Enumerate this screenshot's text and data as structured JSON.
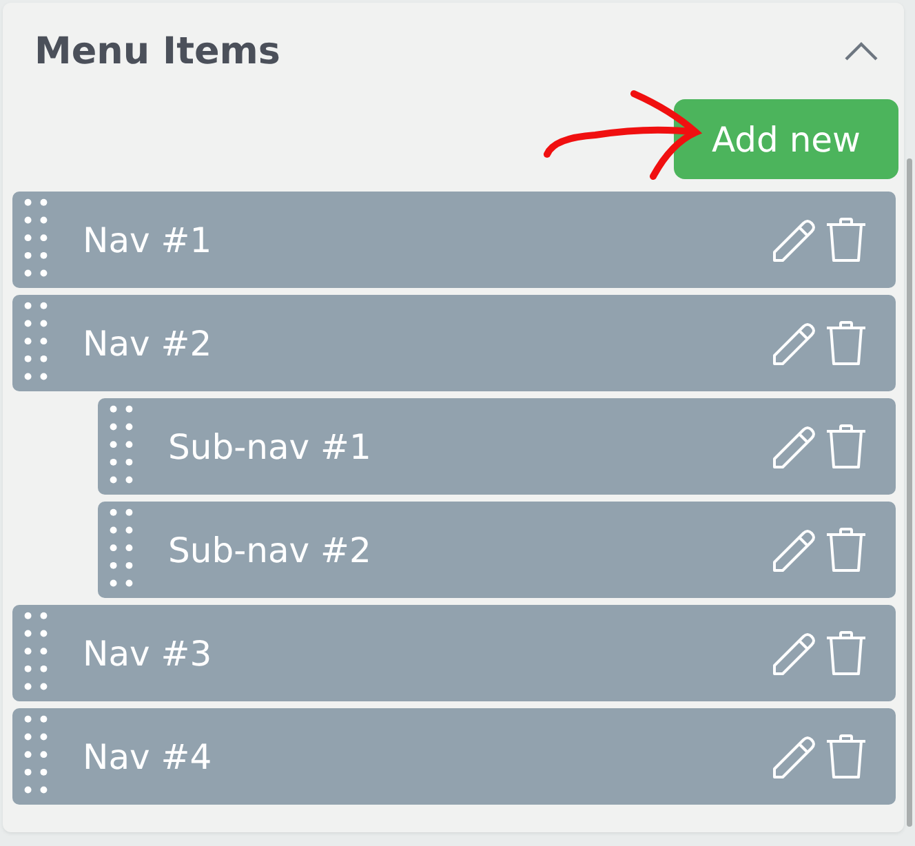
{
  "panel": {
    "title": "Menu Items",
    "expanded": true
  },
  "add_button": {
    "label": "Add new"
  },
  "menu_items": [
    {
      "label": "Nav #1"
    },
    {
      "label": "Nav #2",
      "children": [
        {
          "label": "Sub-nav #1"
        },
        {
          "label": "Sub-nav #2"
        }
      ]
    },
    {
      "label": "Nav #3"
    },
    {
      "label": "Nav #4"
    }
  ]
}
